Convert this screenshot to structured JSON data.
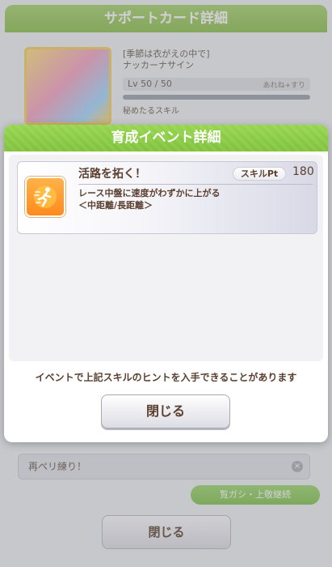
{
  "background": {
    "title": "サポートカード詳細",
    "card_line1": "[季節は衣がえの中で]",
    "card_line2": "ナッカーナサイン",
    "level": "Lv 50 / 50",
    "level_right": "あれね+すり",
    "sub": "秘めたるスキル",
    "input_text": "再ペリ練り！",
    "green_button": "覧ガシ・上敬継続",
    "close_label": "閉じる"
  },
  "modal": {
    "title": "育成イベント詳細",
    "skill": {
      "name": "活路を拓く！",
      "pt_label": "スキルPt",
      "pt_value": "180",
      "desc_line1": "レース中盤に速度がわずかに上がる",
      "desc_line2": "＜中距離/長距離＞",
      "icon": "runner-speed-icon",
      "icon_color": "#ff9a2e"
    },
    "notice": "イベントで上記スキルのヒントを入手できることがあります",
    "close_label": "閉じる"
  },
  "colors": {
    "accent": "#8cc63f",
    "text": "#5b4030"
  }
}
